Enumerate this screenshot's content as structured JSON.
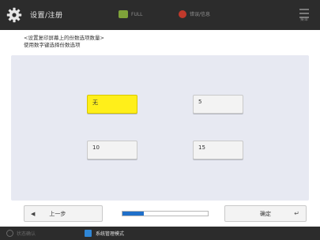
{
  "header": {
    "title": "设置/注册",
    "status_items": [
      {
        "icon": "status-ok-icon",
        "label": "FULL",
        "color": "#7fa33a"
      },
      {
        "icon": "status-error-icon",
        "label": "错误/信息",
        "color": "#c0392b"
      }
    ],
    "menu_label": "菜单"
  },
  "instruction": {
    "line1": "<设置复印屏幕上的份数选项数量>",
    "line2": "使用数字键选择份数选项"
  },
  "options": [
    {
      "label": "无",
      "selected": true
    },
    {
      "label": "5",
      "selected": false
    },
    {
      "label": "10",
      "selected": false
    },
    {
      "label": "15",
      "selected": false
    }
  ],
  "navigation": {
    "back_label": "上一步",
    "ok_label": "确定",
    "progress_percent": 25
  },
  "footer": {
    "left_label": "状态确认",
    "message": "系统管理模式"
  },
  "colors": {
    "header_bg": "#2c2c2c",
    "panel_bg": "#e7e9f2",
    "selected": "#ffef1a",
    "progress": "#1f6fc9"
  }
}
